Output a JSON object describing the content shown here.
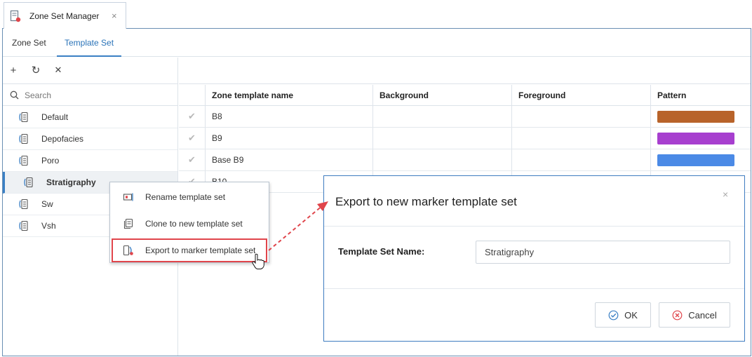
{
  "window": {
    "tab_title": "Zone Set Manager",
    "tab_close": "×",
    "tab_icon": "zone-set-manager-icon"
  },
  "subtabs": [
    {
      "label": "Zone Set",
      "active": false
    },
    {
      "label": "Template Set",
      "active": true
    }
  ],
  "toolbar": {
    "add_icon": "+",
    "refresh_icon": "↻",
    "delete_icon": "✕"
  },
  "search": {
    "placeholder": "Search"
  },
  "template_sets": [
    {
      "label": "Default",
      "selected": false
    },
    {
      "label": "Depofacies",
      "selected": false
    },
    {
      "label": "Poro",
      "selected": false
    },
    {
      "label": "Stratigraphy",
      "selected": true
    },
    {
      "label": "Sw",
      "selected": false
    },
    {
      "label": "Vsh",
      "selected": false
    }
  ],
  "grid": {
    "columns": [
      "Zone template name",
      "Background",
      "Foreground",
      "Pattern"
    ],
    "rows": [
      {
        "check": "✔",
        "name": "B8",
        "pattern_color": "#b8632a"
      },
      {
        "check": "✔",
        "name": "B9",
        "pattern_color": "#a73fcf"
      },
      {
        "check": "✔",
        "name": "Base B9",
        "pattern_color": "#4b8ae6"
      },
      {
        "check": "✔",
        "name": "B10",
        "pattern_color": ""
      }
    ]
  },
  "context_menu": {
    "items": [
      {
        "label": "Rename template set",
        "icon": "rename-icon"
      },
      {
        "label": "Clone to new template set",
        "icon": "clone-icon"
      },
      {
        "label": "Export to marker template set",
        "icon": "export-icon",
        "highlighted": true
      }
    ]
  },
  "dialog": {
    "title": "Export to new marker template set",
    "close": "×",
    "field_label": "Template Set Name:",
    "field_value": "Stratigraphy",
    "ok_label": "OK",
    "cancel_label": "Cancel"
  },
  "colors": {
    "accent": "#3a7fc4",
    "highlight_red": "#e0454b",
    "dialog_border": "#3f7cc0"
  }
}
